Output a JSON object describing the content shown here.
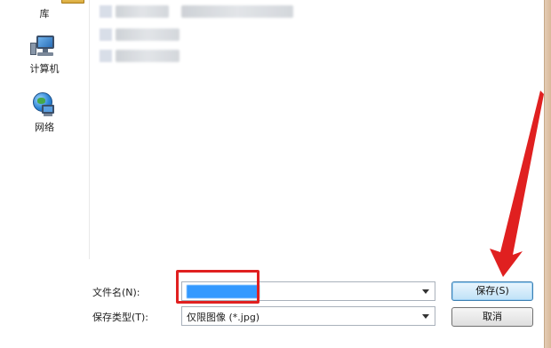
{
  "sidebar": {
    "items": [
      {
        "label": "库",
        "icon": "library-icon"
      },
      {
        "label": "计算机",
        "icon": "computer-icon"
      },
      {
        "label": "网络",
        "icon": "network-icon"
      }
    ]
  },
  "file_list": {
    "rows": [
      {
        "name": "",
        "blurred": true
      },
      {
        "name": "",
        "blurred": true
      },
      {
        "name": "",
        "blurred": true
      }
    ]
  },
  "form": {
    "filename_label": "文件名(N):",
    "filename_value": "",
    "filetype_label": "保存类型(T):",
    "filetype_value": "仅限图像 (*.jpg)"
  },
  "buttons": {
    "save_label": "保存(S)",
    "cancel_label": "取消"
  },
  "annotations": {
    "highlight_color": "#e02020",
    "arrow_color": "#e02020"
  }
}
